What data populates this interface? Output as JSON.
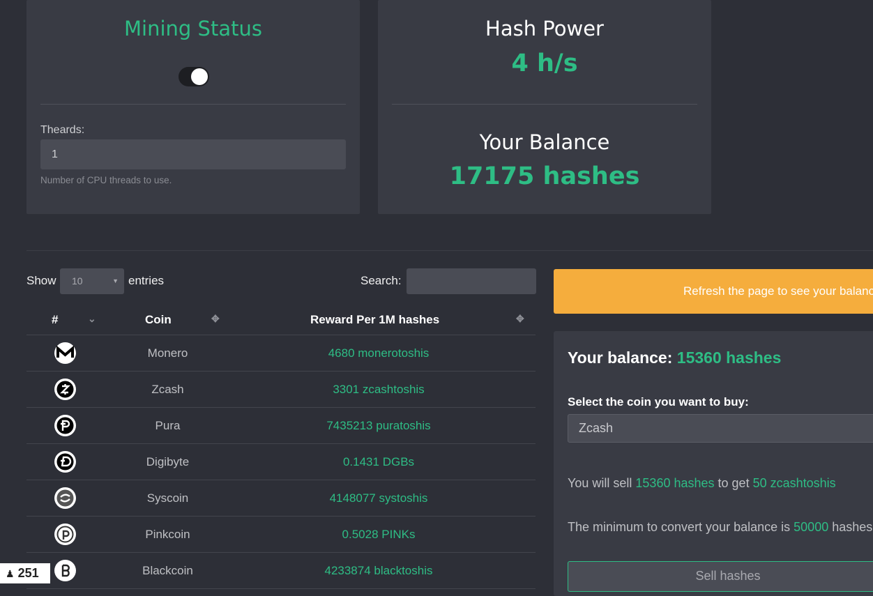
{
  "mining": {
    "title": "Mining Status",
    "toggle_on": true,
    "threads_label": "Theards:",
    "threads_value": "1",
    "threads_help": "Number of CPU threads to use."
  },
  "hash": {
    "power_title": "Hash Power",
    "power_value": "4 h/s",
    "balance_title": "Your Balance",
    "balance_value": "17175 hashes"
  },
  "table_controls": {
    "show_label": "Show",
    "entries_value": "10",
    "entries_label": "entries",
    "search_label": "Search:"
  },
  "table": {
    "headers": [
      "#",
      "Coin",
      "Reward Per 1M hashes"
    ],
    "rows": [
      {
        "icon": "monero-icon",
        "coin": "Monero",
        "reward": "4680 monerotoshis"
      },
      {
        "icon": "zcash-icon",
        "coin": "Zcash",
        "reward": "3301 zcashtoshis"
      },
      {
        "icon": "pura-icon",
        "coin": "Pura",
        "reward": "7435213 puratoshis"
      },
      {
        "icon": "digibyte-icon",
        "coin": "Digibyte",
        "reward": "0.1431 DGBs"
      },
      {
        "icon": "syscoin-icon",
        "coin": "Syscoin",
        "reward": "4148077 systoshis"
      },
      {
        "icon": "pinkcoin-icon",
        "coin": "Pinkcoin",
        "reward": "0.5028 PINKs"
      },
      {
        "icon": "blackcoin-icon",
        "coin": "Blackcoin",
        "reward": "4233874 blacktoshis"
      }
    ]
  },
  "alert": {
    "text": "Refresh the page to see your balance"
  },
  "exchange": {
    "balance_label": "Your balance:",
    "balance_value": "15360 hashes",
    "select_label": "Select the coin you want to buy:",
    "selected_coin": "Zcash",
    "sell_prefix": "You will sell",
    "sell_amount": "15360 hashes",
    "sell_mid": "to get",
    "sell_result": "50 zcashtoshis",
    "min_prefix": "The minimum to convert your balance is",
    "min_amount": "50000",
    "min_suffix": "hashes.",
    "sell_button": "Sell hashes"
  },
  "online": {
    "count": "251"
  },
  "colors": {
    "accent": "#2ebd85",
    "alert": "#f5ad3d",
    "background": "#2d2f37",
    "card": "#393b44"
  }
}
